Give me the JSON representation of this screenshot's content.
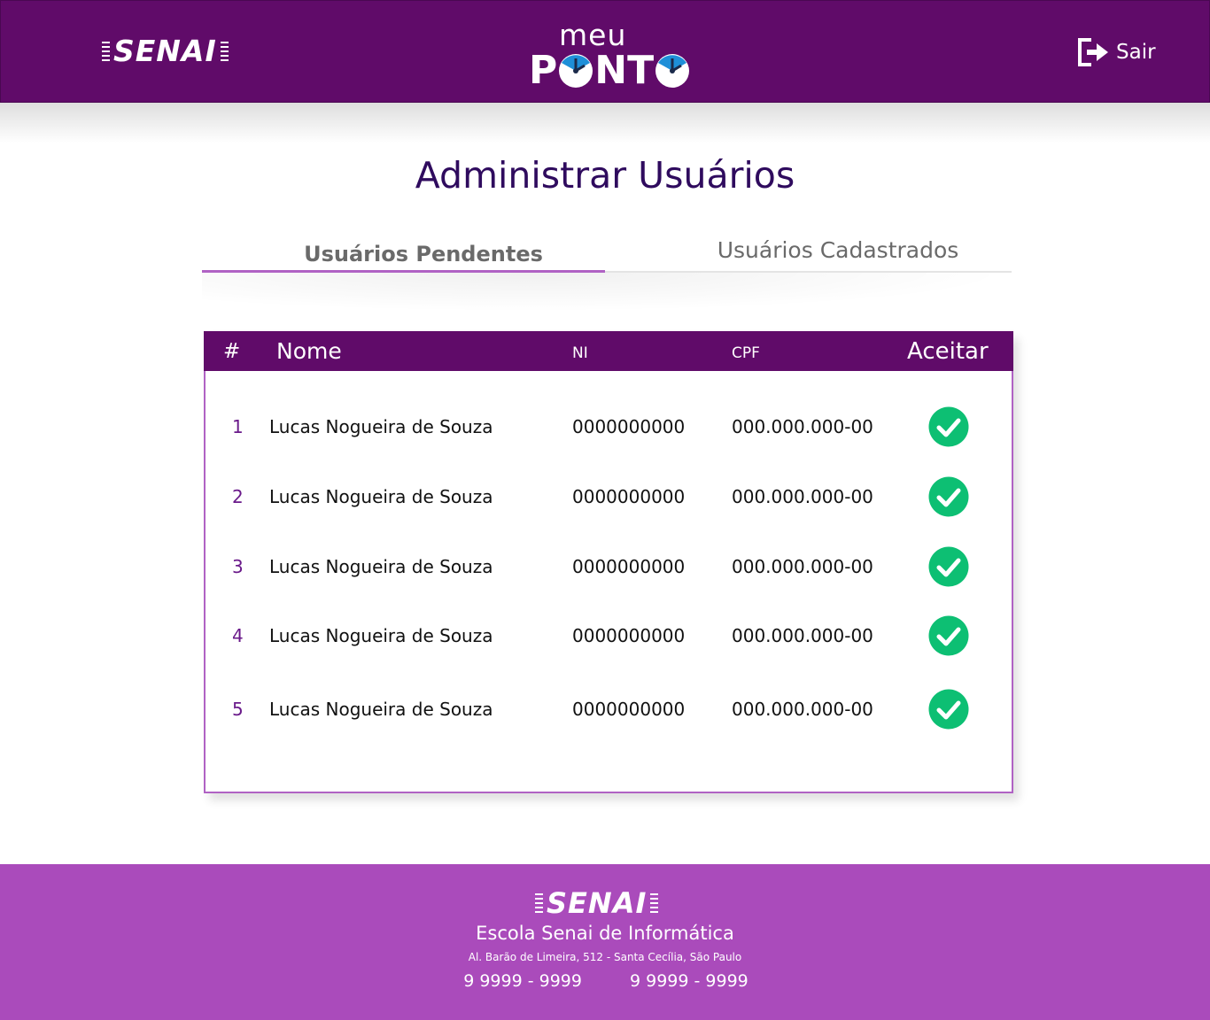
{
  "header": {
    "brand": "SENAI",
    "app_logo": {
      "top": "meu",
      "bottom": "PONTO"
    },
    "logout_label": "Sair"
  },
  "page": {
    "title": "Administrar Usuários"
  },
  "tabs": [
    {
      "label": "Usuários Pendentes",
      "active": true
    },
    {
      "label": "Usuários Cadastrados",
      "active": false
    }
  ],
  "table": {
    "columns": [
      "#",
      "Nome",
      "NI",
      "CPF",
      "Aceitar"
    ],
    "rows": [
      {
        "idx": "1",
        "nome": "Lucas Nogueira de Souza",
        "ni": "0000000000",
        "cpf": "000.000.000-00"
      },
      {
        "idx": "2",
        "nome": "Lucas Nogueira de Souza",
        "ni": "0000000000",
        "cpf": "000.000.000-00"
      },
      {
        "idx": "3",
        "nome": "Lucas Nogueira de Souza",
        "ni": "0000000000",
        "cpf": "000.000.000-00"
      },
      {
        "idx": "4",
        "nome": "Lucas Nogueira de Souza",
        "ni": "0000000000",
        "cpf": "000.000.000-00"
      },
      {
        "idx": "5",
        "nome": "Lucas Nogueira de Souza",
        "ni": "0000000000",
        "cpf": "000.000.000-00"
      }
    ],
    "accept_icon": "check-circle-icon"
  },
  "footer": {
    "brand": "SENAI",
    "school": "Escola Senai de Informática",
    "address": "Al. Barão de Limeira, 512 - Santa Cecília, São Paulo",
    "phones": [
      "9 9999 - 9999",
      "9 9999 - 9999"
    ]
  },
  "colors": {
    "header_bg": "#600b69",
    "footer_bg": "#aa4bbb",
    "title": "#2f0b5e",
    "accent": "#b062c4",
    "accept_green": "#0dbf73",
    "clock_blue": "#1e8fd8"
  }
}
